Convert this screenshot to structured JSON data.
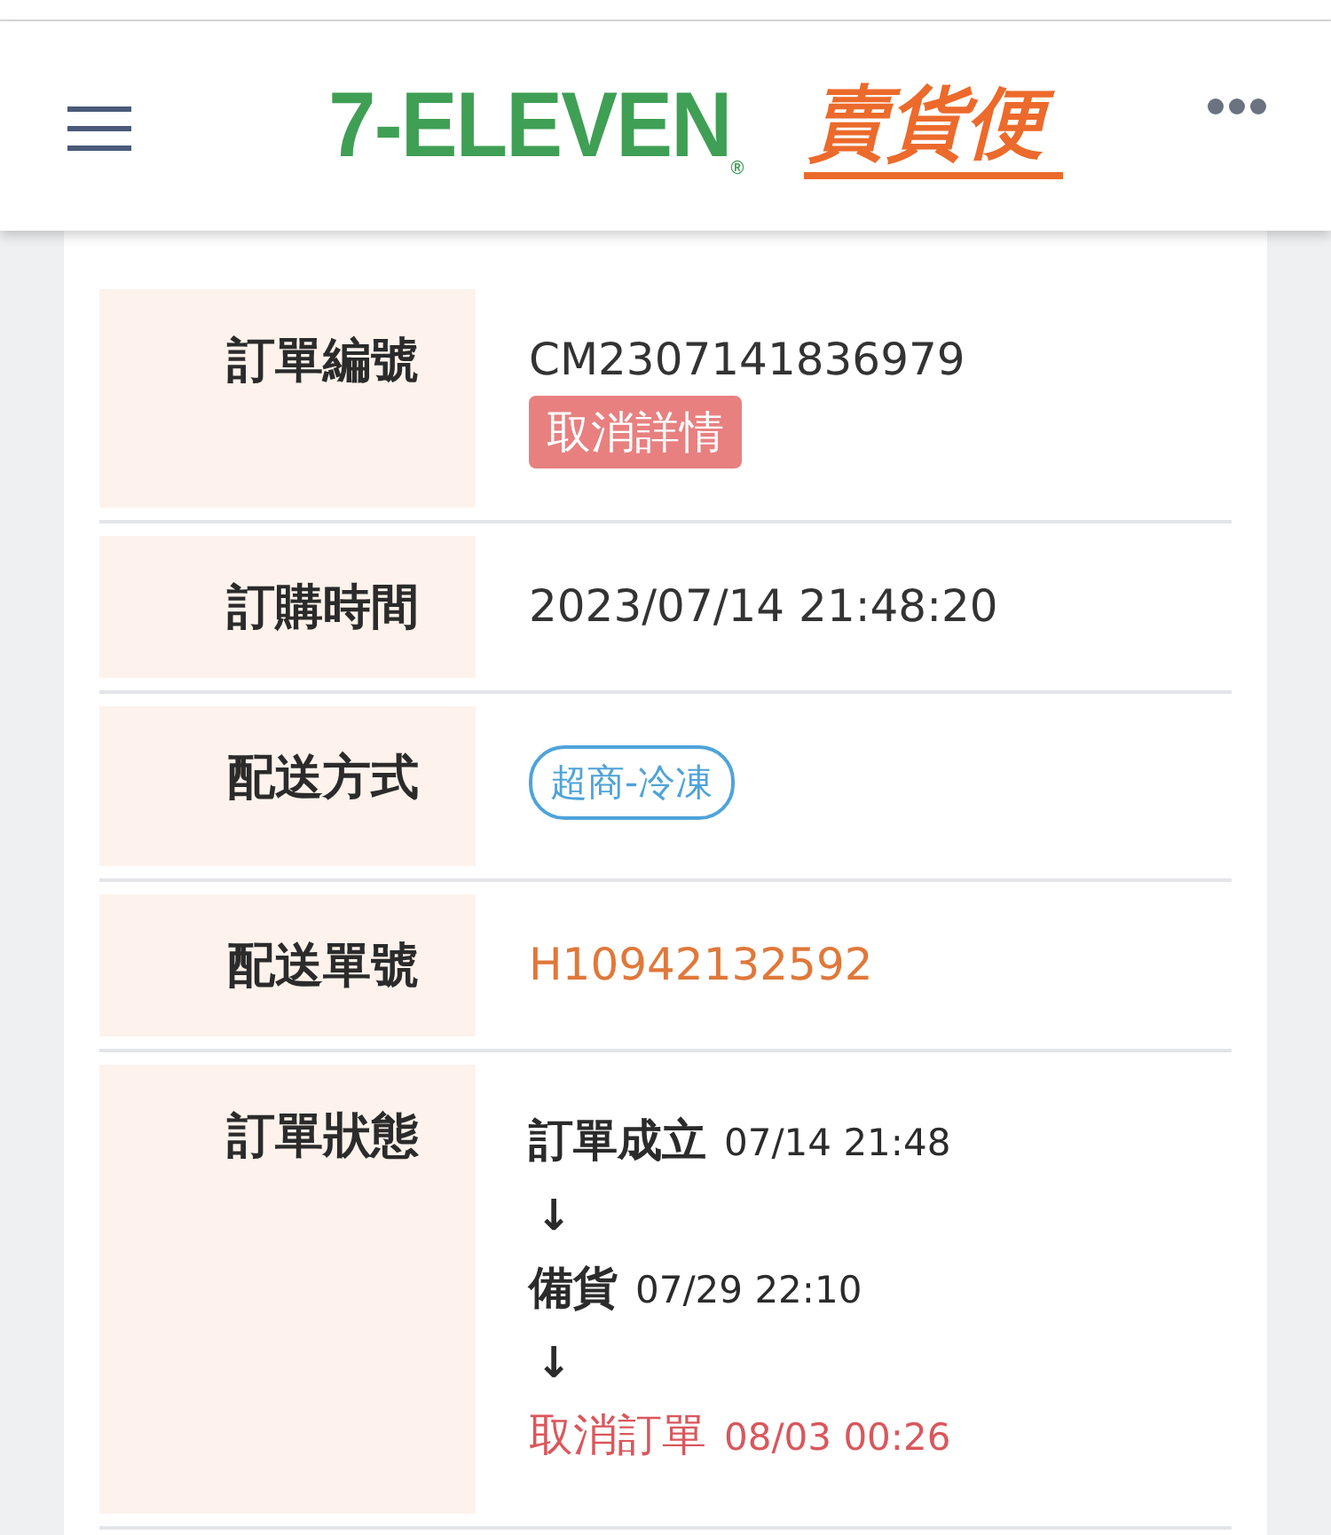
{
  "header": {
    "logo": {
      "brand": "7-ELEVEN",
      "mark": "®",
      "service": "賣貨便"
    }
  },
  "rows": [
    {
      "label": "訂單編號",
      "kind": "text_badge",
      "value": "CM2307141836979",
      "badge": "取消詳情"
    },
    {
      "label": "訂購時間",
      "kind": "text",
      "value": "2023/07/14 21:48:20"
    },
    {
      "label": "配送方式",
      "kind": "pill",
      "value": "超商-冷凍"
    },
    {
      "label": "配送單號",
      "kind": "link",
      "value": "H10942132592"
    },
    {
      "label": "訂單狀態",
      "kind": "timeline",
      "steps": [
        {
          "status": "訂單成立",
          "time": "07/14 21:48",
          "cancelled": false
        },
        {
          "status": "備貨",
          "time": "07/29 22:10",
          "cancelled": false
        },
        {
          "status": "取消訂單",
          "time": "08/03 00:26",
          "cancelled": true
        }
      ],
      "arrow": "↓"
    }
  ]
}
